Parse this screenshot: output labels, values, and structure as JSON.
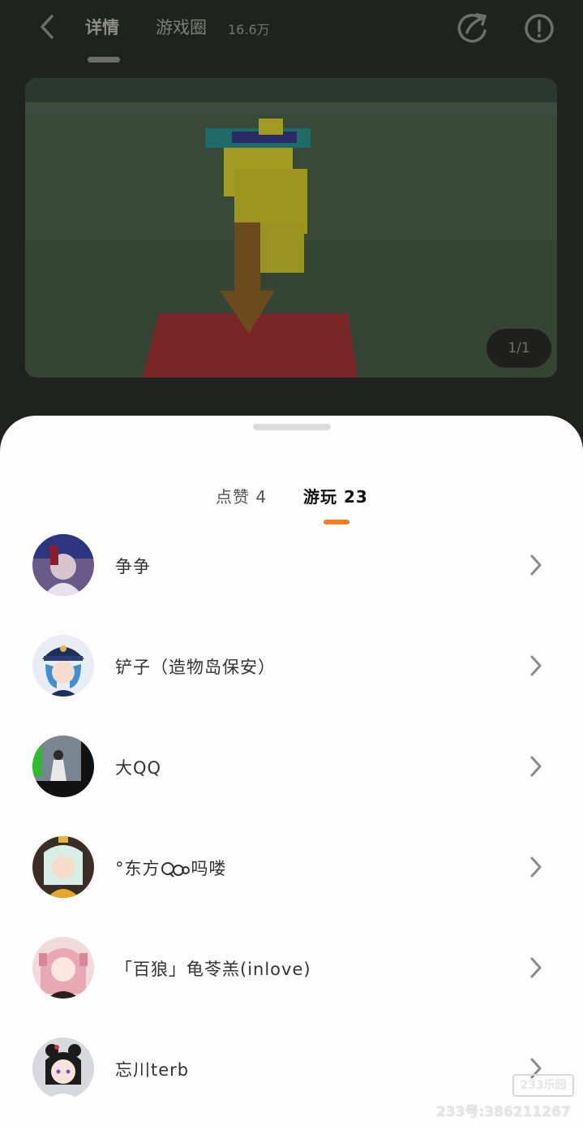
{
  "header": {
    "tab_details": "详情",
    "tab_game_circle": "游戏圈",
    "game_circle_count": "16.6万"
  },
  "media": {
    "page_indicator": "1/1"
  },
  "sheet": {
    "tab_likes": "点赞 4",
    "tab_plays": "游玩 23",
    "users": [
      {
        "name": "争争",
        "avatar": "avatar-icon"
      },
      {
        "name": "铲子（造物岛保安）",
        "avatar": "avatar-icon"
      },
      {
        "name": "大QQ",
        "avatar": "avatar-icon"
      },
      {
        "name": "°东方",
        "name_suffix": "吗喽",
        "avatar": "avatar-icon"
      },
      {
        "name": "「百狼」龟苓羔(inlove)",
        "avatar": "avatar-icon"
      },
      {
        "name": "忘川terb",
        "avatar": "avatar-icon"
      }
    ]
  },
  "watermark": {
    "logo": "233乐园",
    "account": "233号:386211267"
  },
  "colors": {
    "accent": "#ff7a21",
    "overlay": "#1f221e",
    "sheet": "#fdfdfe"
  }
}
